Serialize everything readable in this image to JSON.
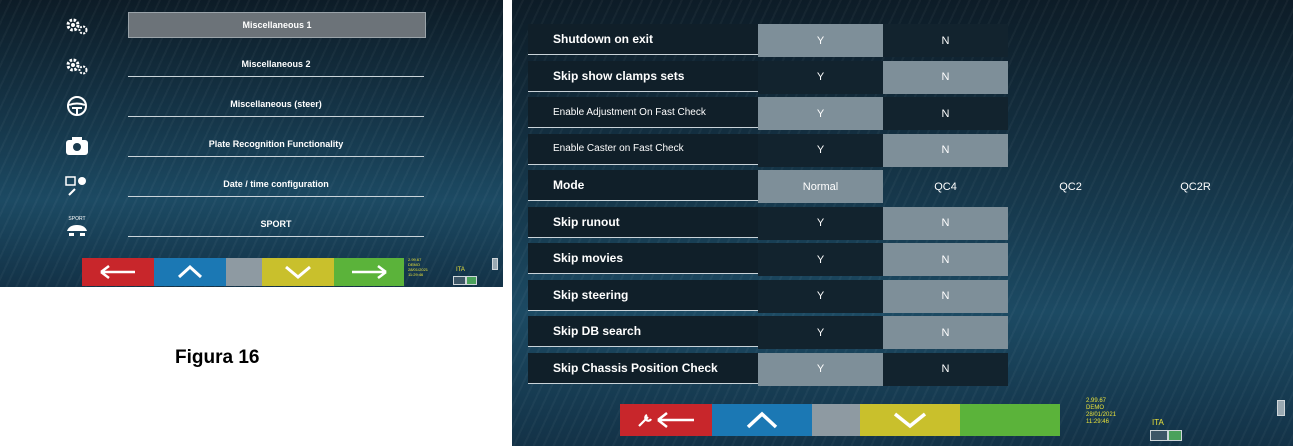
{
  "left_screen": {
    "menu": [
      {
        "label": "Miscellaneous 1",
        "icon": "gears-icon",
        "selected": true
      },
      {
        "label": "Miscellaneous 2",
        "icon": "gears-icon",
        "selected": false
      },
      {
        "label": "Miscellaneous (steer)",
        "icon": "steering-wheel-icon",
        "selected": false
      },
      {
        "label": "Plate Recognition Functionality",
        "icon": "camera-icon",
        "selected": false
      },
      {
        "label": "Date / time configuration",
        "icon": "calendar-clock-icon",
        "selected": false
      },
      {
        "label": "SPORT",
        "icon": "sport-car-icon",
        "icon_text": "SPORT",
        "selected": false
      }
    ],
    "status": {
      "version": "2.99.67",
      "mode": "DEMO",
      "date": "28/01/2021",
      "time": "11:29:46",
      "language": "ITA"
    }
  },
  "caption": "Figura 16",
  "right_screen": {
    "rows": [
      {
        "label": "Shutdown on exit",
        "bold": true,
        "options": [
          "Y",
          "N"
        ],
        "selected": 0
      },
      {
        "label": "Skip show clamps sets",
        "bold": true,
        "options": [
          "Y",
          "N"
        ],
        "selected": 1
      },
      {
        "label": "Enable Adjustment On Fast Check",
        "bold": false,
        "options": [
          "Y",
          "N"
        ],
        "selected": 0
      },
      {
        "label": "Enable Caster on Fast Check",
        "bold": false,
        "options": [
          "Y",
          "N"
        ],
        "selected": 1
      },
      {
        "label": "Mode",
        "bold": true,
        "options": [
          "Normal",
          "QC4",
          "QC2",
          "QC2R"
        ],
        "selected": 0
      },
      {
        "label": "Skip runout",
        "bold": true,
        "options": [
          "Y",
          "N"
        ],
        "selected": 1
      },
      {
        "label": "Skip movies",
        "bold": true,
        "options": [
          "Y",
          "N"
        ],
        "selected": 1
      },
      {
        "label": "Skip steering",
        "bold": true,
        "options": [
          "Y",
          "N"
        ],
        "selected": 1
      },
      {
        "label": "Skip DB search",
        "bold": true,
        "options": [
          "Y",
          "N"
        ],
        "selected": 1
      },
      {
        "label": "Skip Chassis Position Check",
        "bold": true,
        "options": [
          "Y",
          "N"
        ],
        "selected": 0
      }
    ],
    "status": {
      "version": "2.99.67",
      "mode": "DEMO",
      "date": "28/01/2021",
      "time": "11:29:46",
      "language": "ITA"
    }
  },
  "colors": {
    "back": "#c8262b",
    "up": "#1b78b4",
    "middle": "#8e9aa2",
    "down": "#c9c02c",
    "next": "#5bb33a",
    "status_text": "#e9e23a"
  }
}
